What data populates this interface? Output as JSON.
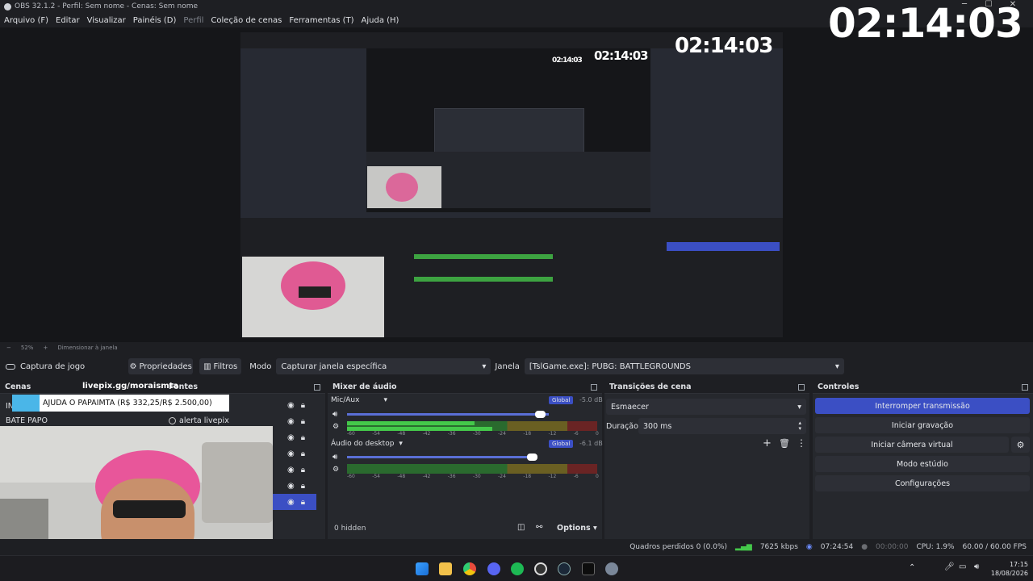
{
  "window": {
    "title": "OBS 32.1.2 - Perfil: Sem nome - Cenas: Sem nome"
  },
  "menu": [
    "Arquivo (F)",
    "Editar",
    "Visualizar",
    "Painéis (D)",
    "Perfil",
    "Coleção de cenas",
    "Ferramentas (T)",
    "Ajuda (H)"
  ],
  "clock": "02:14:03",
  "inner_clock_1": "02:14:03",
  "inner_clock_2": "02:14:03",
  "inner_clock_3": "02:14:03",
  "zoom": {
    "percent": "52%",
    "mode": "Dimensionar à janela"
  },
  "source_toolbar": {
    "source_name": "Captura de jogo",
    "properties": "Propriedades",
    "filters": "Filtros",
    "mode_label": "Modo",
    "mode_value": "Capturar janela específica",
    "window_label": "Janela",
    "window_value": "[TslGame.exe]: PUBG: BATTLEGROUNDS"
  },
  "scenes": {
    "title": "Cenas",
    "url_overlay": "livepix.gg/moraismta",
    "items": [
      "IN",
      "BATE PAPO"
    ],
    "donation_banner": "AJUDA O PAPAIMTA (R$ 332,25/R$ 2.500,00)"
  },
  "sources": {
    "title": "Fontes",
    "items": [
      "",
      "alerta livepix"
    ],
    "hidden_count": "0 hidden",
    "options": "Options"
  },
  "mixer": {
    "title": "Mixer de áudio",
    "channels": [
      {
        "name": "Mic/Aux",
        "badge": "Global",
        "db": "-5.0 dB",
        "volume": 0.78
      },
      {
        "name": "Áudio do desktop",
        "badge": "Global",
        "db": "-6.1 dB",
        "volume": 0.74
      }
    ],
    "scale": [
      "-60",
      "-54",
      "-48",
      "-42",
      "-36",
      "-30",
      "-24",
      "-18",
      "-12",
      "-6",
      "0"
    ]
  },
  "transitions": {
    "title": "Transições de cena",
    "type": "Esmaecer",
    "duration_label": "Duração",
    "duration_value": "300 ms"
  },
  "controls": {
    "title": "Controles",
    "stop_stream": "Interromper transmissão",
    "start_record": "Iniciar gravação",
    "virtual_cam": "Iniciar câmera virtual",
    "studio_mode": "Modo estúdio",
    "settings": "Configurações"
  },
  "status": {
    "dropped": "Quadros perdidos 0 (0.0%)",
    "bitrate": "7625 kbps",
    "stream_time": "07:24:54",
    "record_time": "00:00:00",
    "cpu": "CPU: 1.9%",
    "fps": "60.00 / 60.00 FPS"
  },
  "tray": {
    "time": "17:15",
    "date": "18/08/2026"
  },
  "colors": {
    "accent": "#3b4fc4",
    "meter_green": "#44c84a",
    "meter_yellow": "#c8b43a",
    "meter_red": "#c83a3a"
  }
}
